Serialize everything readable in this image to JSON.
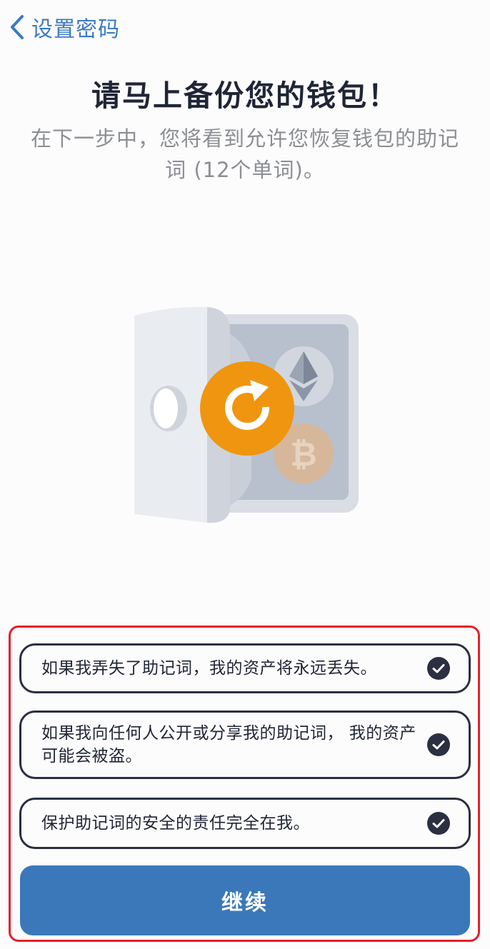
{
  "nav": {
    "back_label": "设置密码"
  },
  "header": {
    "title": "请马上备份您的钱包！",
    "subtitle": "在下一步中，您将看到允许您恢复钱包的助记词 (12个单词)。"
  },
  "illustration": {
    "icons": [
      "safe-icon",
      "refresh-icon",
      "ethereum-icon",
      "bitcoin-icon"
    ]
  },
  "checklist": [
    {
      "text": "如果我弄失了助记词，我的资产将永远丢失。",
      "checked": true
    },
    {
      "text": "如果我向任何人公开或分享我的助记词， 我的资产可能会被盗。",
      "checked": true
    },
    {
      "text": "保护助记词的安全的责任完全在我。",
      "checked": true
    }
  ],
  "actions": {
    "continue_label": "继续"
  },
  "colors": {
    "accent": "#3b78ba",
    "highlight_border": "#e3202b",
    "refresh_badge": "#f0950f"
  }
}
